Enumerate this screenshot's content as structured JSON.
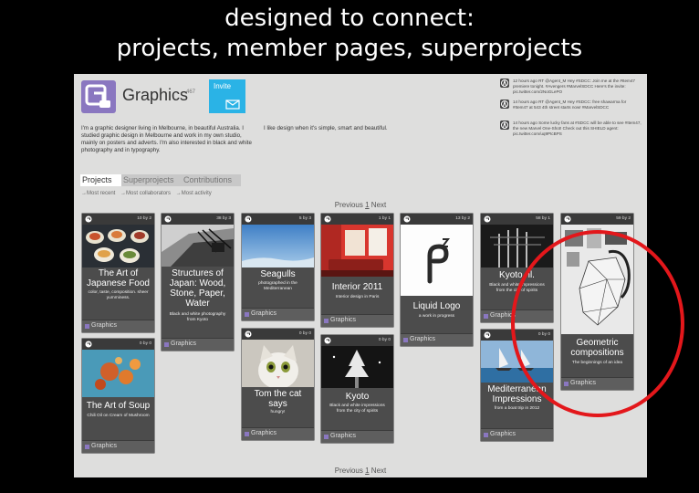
{
  "slide": {
    "title_line1": "designed to connect:",
    "title_line2": "projects, member pages, superprojects"
  },
  "colors": {
    "accent": "#8a77c0",
    "invite": "#2ab3e6",
    "highlight": "#e3171b"
  },
  "header": {
    "group_name": "Graphics",
    "member_count": "467",
    "invite_label": "Invite",
    "bio": "I'm a graphic designer living in Melbourne, in beautiful Australia. I studied graphic design in Melbourne and work in my own studio, mainly on posters and adverts. I'm also interested in black and white photography and in typography.",
    "tagline": "I like design when it's simple, smart and beautiful."
  },
  "tweets": [
    {
      "text": "12 hours ago RT @Agent_M Hey #SDCC: Join me at the #Item47 premiere tonight. #Avengers #MarvelSDCC Here's the invite: pic.twitter.com/2NoGLePO"
    },
    {
      "text": "14 hours ago RT @Agent_M Hey #SDCC: free shawarma for #Item47 at 543 4th street starts now! #MarvelSDCC"
    },
    {
      "text": "14 hours ago Some lucky fans at #SDCC will be able to see #Item47, the new Marvel One-Shot! Check out this SHIELD agent: pic.twitter.com/uq9PtcBPS"
    }
  ],
  "tabs": [
    {
      "label": "Projects",
      "active": true
    },
    {
      "label": "Superprojects",
      "active": false
    },
    {
      "label": "Contributions",
      "active": false
    }
  ],
  "sort": {
    "most_recent": "→Most recent",
    "most_collaborators": "→Most collaborators",
    "most_activity": "→Most activity"
  },
  "pager": {
    "prev": "Previous",
    "current": "1",
    "next": "Next"
  },
  "cards": [
    {
      "title": "The Art of Japanese Food",
      "desc": "color, taste, composition. sheer yumminess.",
      "counts": "10 by 2",
      "group": "Graphics"
    },
    {
      "title": "Structures of Japan: Wood, Stone, Paper, Water",
      "desc": "Black and white photography from Kyoto",
      "counts": "38 by 3",
      "group": "Graphics"
    },
    {
      "title": "Seagulls",
      "desc": "photographed in the Mediterranean",
      "counts": "5 by 3",
      "group": "Graphics"
    },
    {
      "title": "Interior 2011",
      "desc": "Interior design in Paris",
      "counts": "1 by 1",
      "group": "Graphics"
    },
    {
      "title": "Liquid Logo",
      "desc": "a work in progress",
      "counts": "13 by 2",
      "group": "Graphics"
    },
    {
      "title": "Kyoto nl.",
      "desc": "Black and white impressions from the city of spirits",
      "counts": "58 by 1",
      "group": "Graphics"
    },
    {
      "title": "Geometric compositions",
      "desc": "The beginnings of an idea",
      "counts": "59 by 2",
      "group": "Graphics"
    },
    {
      "title": "The Art of Soup",
      "desc": "Chili Oil on Cream of Mushroom",
      "counts": "0 by 0",
      "group": "Graphics"
    },
    {
      "title": "Tom the cat says",
      "desc": "hungry!",
      "counts": "0 by 0",
      "group": "Graphics"
    },
    {
      "title": "Kyoto",
      "desc": "Black and white impressions from the city of spirits",
      "counts": "0 by 0",
      "group": "Graphics"
    },
    {
      "title": "Mediterranean Impressions",
      "desc": "from a boat trip in 2012",
      "counts": "0 by 0",
      "group": "Graphics"
    }
  ]
}
